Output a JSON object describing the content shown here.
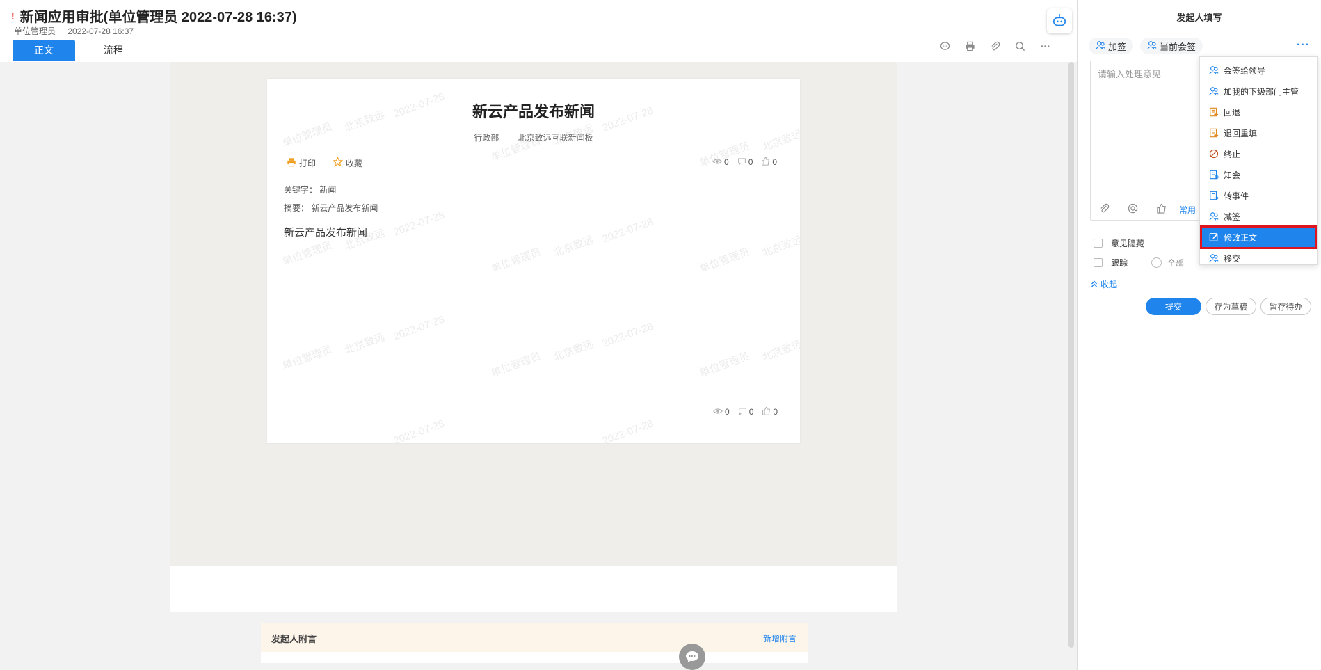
{
  "header": {
    "urgent_mark": "!",
    "title": "新闻应用审批(单位管理员 2022-07-28 16:37)",
    "sender": "单位管理员",
    "datetime": "2022-07-28 16:37",
    "tabs": [
      {
        "label": "正文"
      },
      {
        "label": "流程"
      }
    ],
    "toolbar_icons": [
      "comment-icon",
      "print-icon",
      "attachment-icon",
      "search-icon",
      "more-icon"
    ]
  },
  "document": {
    "title": "新云产品发布新闻",
    "department": "行政部",
    "board": "北京致远互联新闻板",
    "print_label": "打印",
    "favorite_label": "收藏",
    "stats_top": {
      "views": "0",
      "comments": "0",
      "likes": "0"
    },
    "stats_bottom": {
      "views": "0",
      "comments": "0",
      "likes": "0"
    },
    "keywords_label": "关键字：",
    "keywords_value": "新闻",
    "summary_label": "摘要：",
    "summary_value": "新云产品发布新闻",
    "body": "新云产品发布新闻",
    "watermark_texts": [
      "单位管理员",
      "北京致远",
      "2022-07-28"
    ]
  },
  "note_bar": {
    "title": "发起人附言",
    "add_link": "新增附言"
  },
  "right_panel": {
    "title": "发起人填写",
    "tags": [
      {
        "label": "加签"
      },
      {
        "label": "当前会签"
      }
    ],
    "more": "···",
    "opinion_placeholder": "请输入处理意见",
    "common_label": "常用",
    "hide_opinion_label": "意见隐藏",
    "track_label": "跟踪",
    "all_label": "全部",
    "collapse_label": "收起",
    "submit_label": "提交",
    "draft_label": "存为草稿",
    "pending_label": "暂存待办"
  },
  "dropdown": {
    "items": [
      {
        "label": "会签给领导",
        "icon": "users-icon"
      },
      {
        "label": "加我的下级部门主管",
        "icon": "users-icon"
      },
      {
        "label": "回退",
        "icon": "rollback-icon"
      },
      {
        "label": "退回重填",
        "icon": "refill-icon"
      },
      {
        "label": "终止",
        "icon": "stop-icon"
      },
      {
        "label": "知会",
        "icon": "notify-icon"
      },
      {
        "label": "转事件",
        "icon": "transfer-event-icon"
      },
      {
        "label": "减签",
        "icon": "users-icon"
      },
      {
        "label": "修改正文",
        "icon": "edit-icon",
        "selected": true
      },
      {
        "label": "移交",
        "icon": "users-icon"
      }
    ]
  },
  "colors": {
    "accent": "#1f85ec",
    "highlight_border": "#e0141e",
    "urgent": "#e02020",
    "note_bg": "#fdf5ea"
  }
}
